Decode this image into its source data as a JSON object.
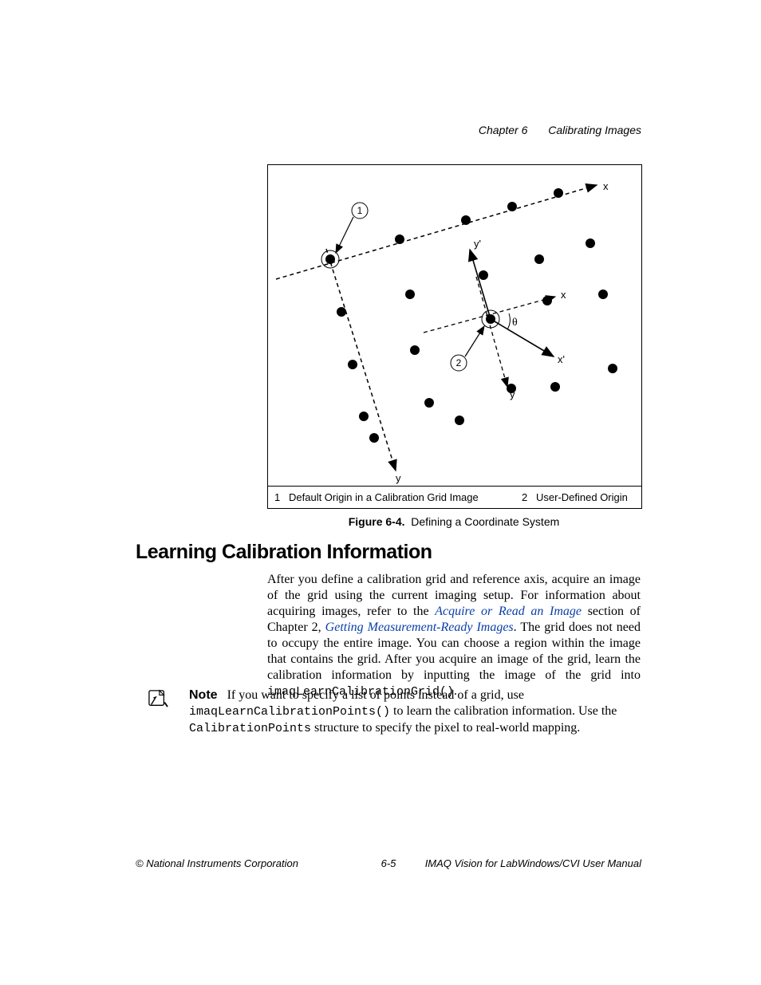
{
  "header": {
    "chapter_label": "Chapter 6",
    "chapter_title": "Calibrating Images"
  },
  "figure": {
    "axis_x": "x",
    "axis_y": "y",
    "axis_xprime": "x'",
    "axis_yprime": "y'",
    "axis_x2": "x",
    "axis_y2": "y",
    "theta": "θ",
    "callout1": "1",
    "callout2": "2",
    "legend": [
      {
        "num": "1",
        "text": "Default Origin in a Calibration Grid Image"
      },
      {
        "num": "2",
        "text": "User-Defined Origin"
      }
    ],
    "caption_bold": "Figure 6-4.",
    "caption_rest": "Defining a Coordinate System"
  },
  "heading": "Learning Calibration Information",
  "paragraph": {
    "p1a": "After you define a calibration grid and reference axis, acquire an image of the grid using the current imaging setup. For information about acquiring images, refer to the ",
    "link1": "Acquire or Read an Image",
    "p1b": " section of Chapter 2, ",
    "link2": "Getting Measurement-Ready Images",
    "p1c": ". The grid does not need to occupy the entire image. You can choose a region within the image that contains the grid. After you acquire an image of the grid, learn the calibration information by inputting the image of the grid into ",
    "code1": "imaqLearnCalibrationGrid()",
    "p1d": "."
  },
  "note": {
    "lead": "Note",
    "n1": "If you want to specify a list of points instead of a grid, use ",
    "code1": "imaqLearnCalibrationPoints()",
    "n2": " to learn the calibration information. Use the ",
    "code2": "CalibrationPoints",
    "n3": " structure to specify the pixel to real-world mapping."
  },
  "footer": {
    "left": "© National Instruments Corporation",
    "center": "6-5",
    "right": "IMAQ Vision for LabWindows/CVI User Manual"
  }
}
